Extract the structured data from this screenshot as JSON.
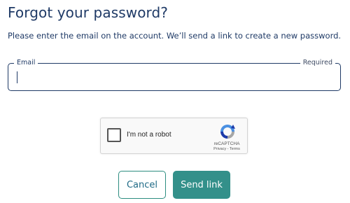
{
  "page": {
    "title": "Forgot your password?",
    "subtitle": "Please enter the email on the account. We’ll send a link to create a new password."
  },
  "email_field": {
    "label": "Email",
    "required_text": "Required",
    "value": "",
    "placeholder": ""
  },
  "captcha": {
    "label": "I'm not a robot",
    "brand": "reCAPTCHA",
    "links": "Privacy - Terms",
    "checked": false,
    "icon": "recaptcha-logo-icon"
  },
  "actions": {
    "cancel_label": "Cancel",
    "send_label": "Send link"
  },
  "colors": {
    "primary_text": "#1f3a66",
    "accent": "#33908a",
    "border": "#1f3a66"
  }
}
